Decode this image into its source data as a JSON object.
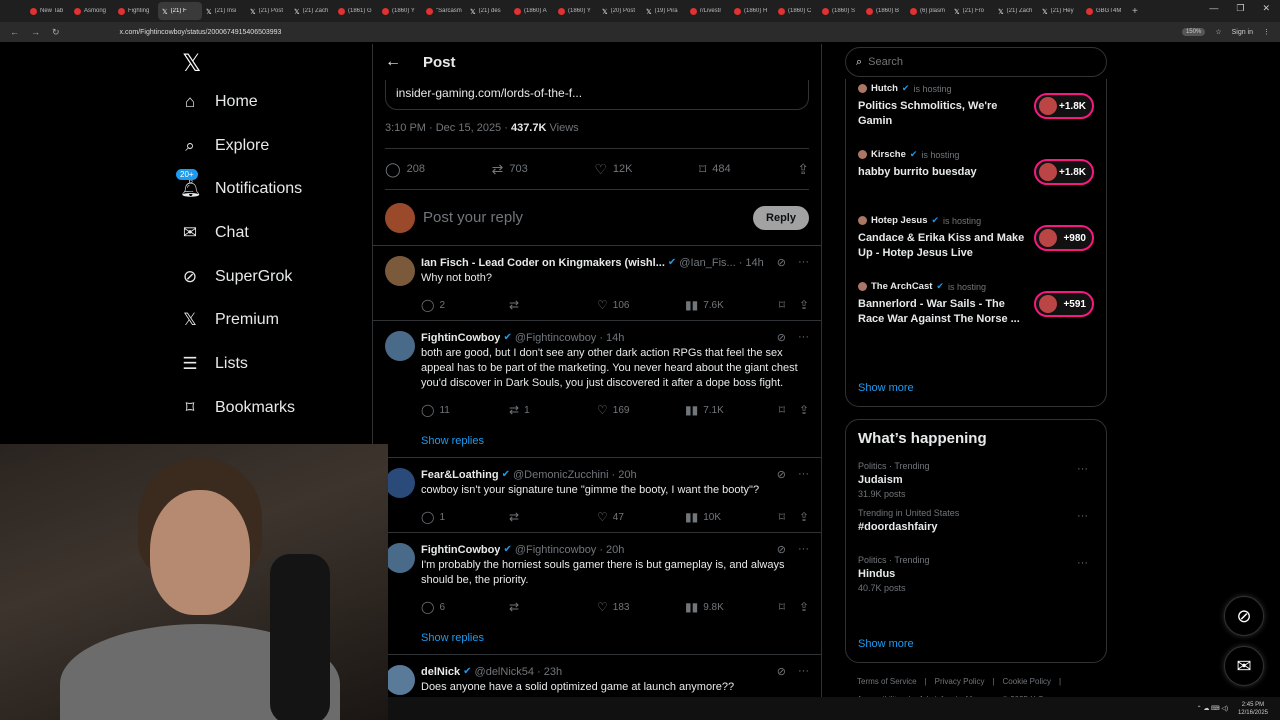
{
  "browser": {
    "tabs": [
      {
        "title": "New Tab",
        "icon": "tab-icon"
      },
      {
        "title": "Asmong",
        "icon": "tab-icon"
      },
      {
        "title": "Fighting",
        "icon": "tab-icon"
      },
      {
        "title": "(21) F",
        "icon": "x-icon",
        "active": true
      },
      {
        "title": "(21) Insi",
        "icon": "x-icon"
      },
      {
        "title": "(21) Post",
        "icon": "x-icon"
      },
      {
        "title": "(21) Zach",
        "icon": "x-icon"
      },
      {
        "title": "(1861) G",
        "icon": "tab-icon"
      },
      {
        "title": "(1860) Y",
        "icon": "tab-icon"
      },
      {
        "title": "\"Sarcasm",
        "icon": "tab-icon"
      },
      {
        "title": "(21) des",
        "icon": "x-icon"
      },
      {
        "title": "(1860) A",
        "icon": "tab-icon"
      },
      {
        "title": "(1860) Y",
        "icon": "tab-icon"
      },
      {
        "title": "(20) Post",
        "icon": "x-icon"
      },
      {
        "title": "(19) Pira",
        "icon": "x-icon"
      },
      {
        "title": "r/Livestr",
        "icon": "tab-icon"
      },
      {
        "title": "(1860) H",
        "icon": "tab-icon"
      },
      {
        "title": "(1860) C",
        "icon": "tab-icon"
      },
      {
        "title": "(1860) S",
        "icon": "tab-icon"
      },
      {
        "title": "(1860) B",
        "icon": "tab-icon"
      },
      {
        "title": "(6) plasm",
        "icon": "tab-icon"
      },
      {
        "title": "(21) Fro",
        "icon": "x-icon"
      },
      {
        "title": "(21) Zach",
        "icon": "x-icon"
      },
      {
        "title": "(21) Hey",
        "icon": "x-icon"
      },
      {
        "title": "GBGT4M",
        "icon": "tab-icon"
      }
    ],
    "url": "x.com/Fightincowboy/status/2000674915406503993",
    "zoom": "150%",
    "signin": "Sign in"
  },
  "nav": {
    "items": [
      {
        "label": "Home",
        "icon": "home-icon"
      },
      {
        "label": "Explore",
        "icon": "search-icon"
      },
      {
        "label": "Notifications",
        "icon": "bell-icon",
        "badge": "20+"
      },
      {
        "label": "Chat",
        "icon": "mail-icon"
      },
      {
        "label": "SuperGrok",
        "icon": "grok-icon"
      },
      {
        "label": "Premium",
        "icon": "x-icon"
      },
      {
        "label": "Lists",
        "icon": "list-icon"
      },
      {
        "label": "Bookmarks",
        "icon": "bookmark-icon"
      }
    ]
  },
  "post": {
    "header": "Post",
    "link": "insider-gaming.com/lords-of-the-f...",
    "time": "3:10 PM · Dec 15, 2025 · ",
    "views": "437.7K",
    "views_label": " Views",
    "replies": "208",
    "reposts": "703",
    "likes": "12K",
    "bookmarks": "484",
    "reply_placeholder": "Post your reply",
    "reply_button": "Reply"
  },
  "replies": [
    {
      "name": "Ian Fisch - Lead Coder on Kingmakers (wishl...",
      "handle": "@Ian_Fis...",
      "time": "· 14h",
      "text": "Why not both?",
      "replies": "2",
      "reposts": "",
      "likes": "106",
      "views": "7.6K",
      "avatar": "#7a5a3a"
    },
    {
      "name": "FightinCowboy",
      "handle": "@Fightincowboy",
      "time": "· 14h",
      "text": "both are good, but I don't see any other dark action RPGs that feel the sex appeal has to be part of the marketing. You never heard about the giant chest you'd discover in Dark Souls, you just discovered it after a dope boss fight.",
      "replies": "11",
      "reposts": "1",
      "likes": "169",
      "views": "7.1K",
      "avatar": "#4a6a8a",
      "show_replies": "Show replies"
    },
    {
      "name": "Fear&Loathing",
      "handle": "@DemonicZucchini",
      "time": "· 20h",
      "text": "cowboy isn't your signature tune \"gimme the booty, I want the booty\"?",
      "replies": "1",
      "reposts": "",
      "likes": "47",
      "views": "10K",
      "avatar": "#2a4a7a"
    },
    {
      "name": "FightinCowboy",
      "handle": "@Fightincowboy",
      "time": "· 20h",
      "text": "I'm probably the horniest souls gamer there is but gameplay is, and always should be, the priority.",
      "replies": "6",
      "reposts": "",
      "likes": "183",
      "views": "9.8K",
      "avatar": "#4a6a8a",
      "show_replies": "Show replies"
    },
    {
      "name": "delNick",
      "handle": "@delNick54",
      "time": "· 23h",
      "text": "Does anyone have a solid optimized game at launch anymore??",
      "replies": "",
      "reposts": "",
      "likes": "",
      "views": "",
      "avatar": "#5a7a9a"
    }
  ],
  "search": {
    "placeholder": "Search"
  },
  "spaces": [
    {
      "host": "Hutch",
      "status": "is hosting",
      "title": "Politics Schmolitics, We're Gamin",
      "count": "+1.8K"
    },
    {
      "host": "Kirsche",
      "status": "is hosting",
      "title": "habby burrito buesday",
      "count": "+1.8K"
    },
    {
      "host": "Hotep Jesus",
      "status": "is hosting",
      "title": "Candace & Erika Kiss and Make Up - Hotep Jesus Live",
      "count": "+980"
    },
    {
      "host": "The ArchCast",
      "status": "is hosting",
      "title": "Bannerlord - War Sails - The Race War Against The Norse ...",
      "count": "+591"
    }
  ],
  "spaces_show_more": "Show more",
  "happening": {
    "title": "What’s happening",
    "trends": [
      {
        "context": "Politics · Trending",
        "name": "Judaism",
        "posts": "31.9K posts"
      },
      {
        "context": "Trending in United States",
        "name": "#doordashfairy",
        "posts": ""
      },
      {
        "context": "Politics · Trending",
        "name": "Hindus",
        "posts": "40.7K posts"
      }
    ],
    "show_more": "Show more"
  },
  "footer": {
    "links": [
      "Terms of Service",
      "|",
      "Privacy Policy",
      "|",
      "Cookie Policy",
      "|",
      "Accessibility",
      "|",
      "Ads info",
      "|",
      "More ···",
      "© 2025 X Corp."
    ]
  },
  "taskbar": {
    "time": "2:45 PM",
    "date": "12/16/2025"
  },
  "colors": {
    "accent": "#1d9bf0",
    "live": "#f91880",
    "bg": "#000000"
  }
}
